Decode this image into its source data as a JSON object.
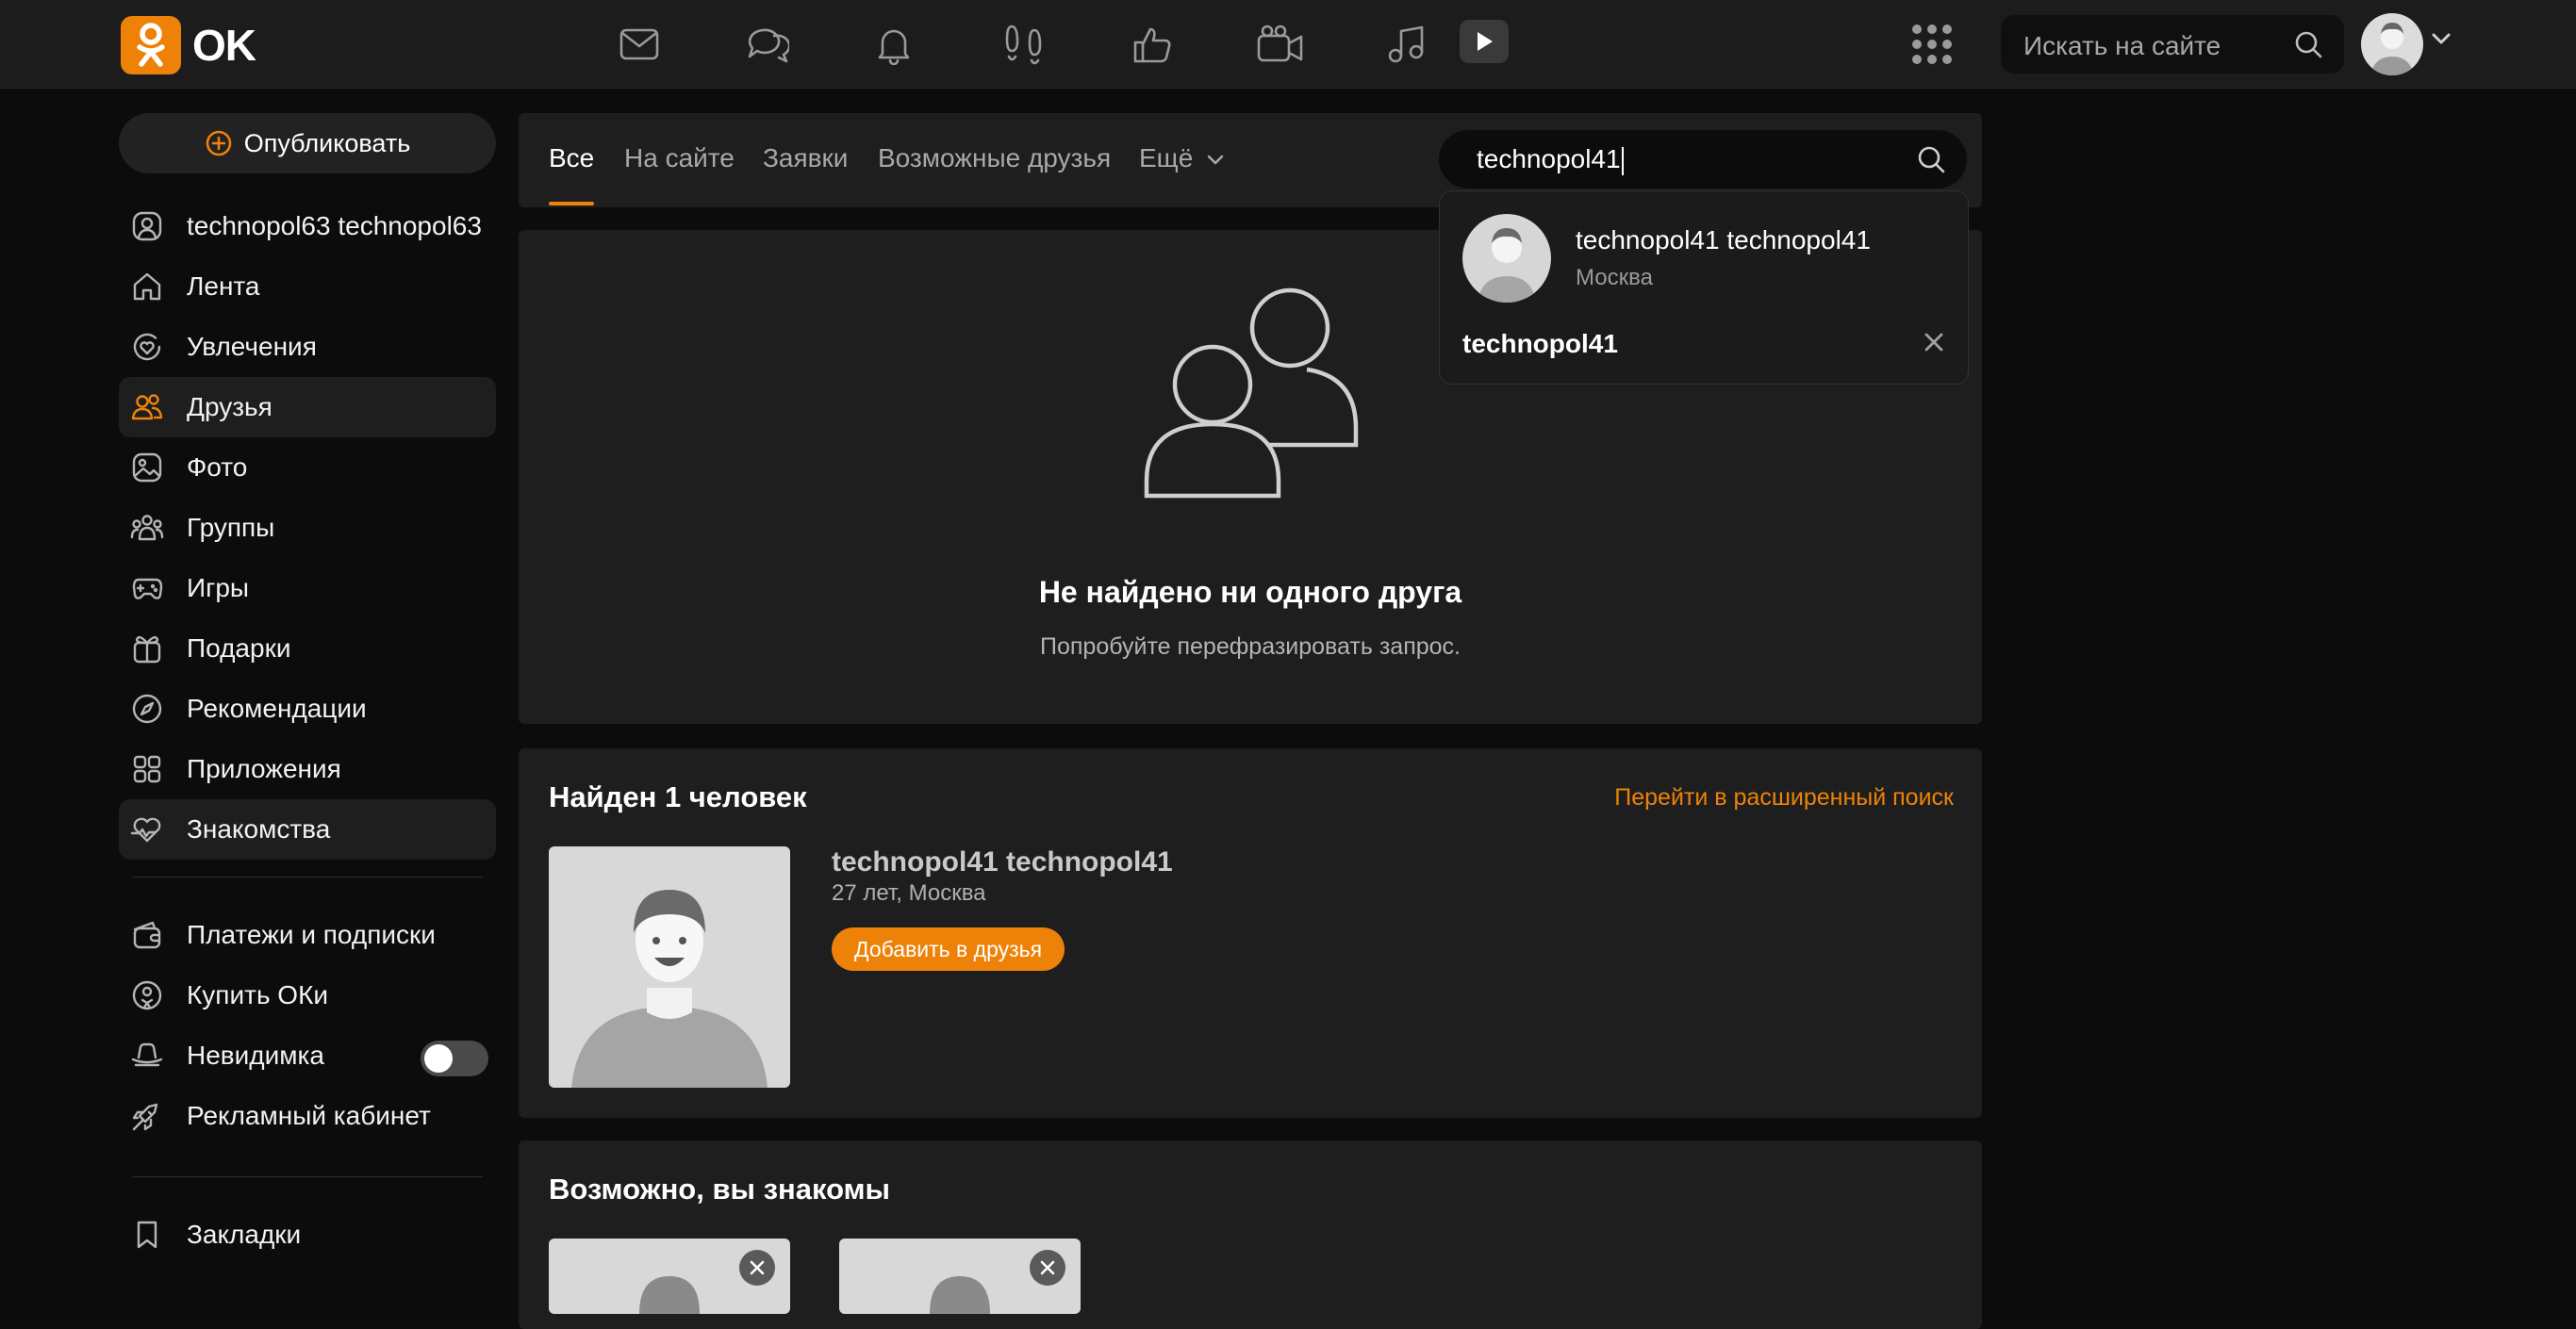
{
  "brand": {
    "name": "OK",
    "accent": "#ee8208"
  },
  "topbar": {
    "icons": [
      "messages-icon",
      "discussions-icon",
      "notifications-icon",
      "guests-icon",
      "events-icon",
      "video-call-icon",
      "music-icon",
      "video-icon"
    ],
    "search_placeholder": "Искать на сайте"
  },
  "sidebar": {
    "publish_label": "Опубликовать",
    "items": [
      {
        "label": "technopol63 technopol63",
        "icon": "profile-icon"
      },
      {
        "label": "Лента",
        "icon": "home-icon"
      },
      {
        "label": "Увлечения",
        "icon": "hobby-icon"
      },
      {
        "label": "Друзья",
        "icon": "friends-icon",
        "active": true
      },
      {
        "label": "Фото",
        "icon": "photo-icon"
      },
      {
        "label": "Группы",
        "icon": "groups-icon"
      },
      {
        "label": "Игры",
        "icon": "games-icon"
      },
      {
        "label": "Подарки",
        "icon": "gift-icon"
      },
      {
        "label": "Рекомендации",
        "icon": "compass-icon"
      },
      {
        "label": "Приложения",
        "icon": "apps-icon"
      },
      {
        "label": "Знакомства",
        "icon": "dating-icon",
        "highlighted": true
      }
    ],
    "secondary_items": [
      {
        "label": "Платежи и подписки",
        "icon": "wallet-icon"
      },
      {
        "label": "Купить ОКи",
        "icon": "coins-icon"
      },
      {
        "label": "Невидимка",
        "icon": "invisible-icon",
        "toggle": false
      },
      {
        "label": "Рекламный кабинет",
        "icon": "ads-icon"
      }
    ],
    "tertiary_items": [
      {
        "label": "Закладки",
        "icon": "bookmark-icon"
      }
    ]
  },
  "tabs": [
    {
      "label": "Все",
      "active": true
    },
    {
      "label": "На сайте"
    },
    {
      "label": "Заявки"
    },
    {
      "label": "Возможные друзья"
    },
    {
      "label": "Ещё"
    }
  ],
  "search": {
    "value": "technopol41",
    "suggestion": {
      "name": "technopol41 technopol41",
      "city": "Москва"
    },
    "recent_query": "technopol41"
  },
  "empty_state": {
    "title": "Не найдено ни одного друга",
    "subtitle": "Попробуйте перефразировать запрос."
  },
  "found": {
    "title": "Найден 1 человек",
    "advanced_link": "Перейти в расширенный поиск",
    "person": {
      "name": "technopol41 technopol41",
      "meta": "27 лет, Москва",
      "action": "Добавить в друзья"
    }
  },
  "maybe": {
    "title": "Возможно, вы знакомы"
  }
}
